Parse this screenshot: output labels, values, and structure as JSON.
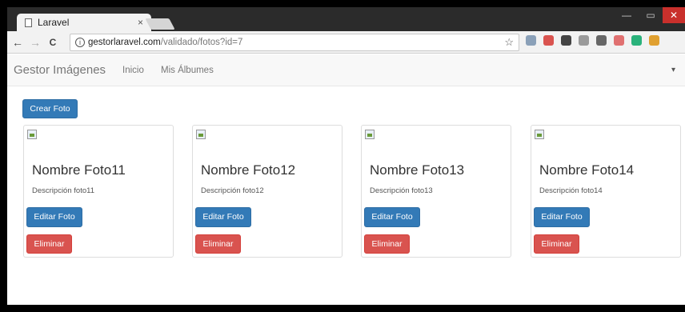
{
  "browser": {
    "tab_title": "Laravel",
    "tab_close": "×",
    "url_host": "gestorlaravel.com",
    "url_path": "/validado/fotos?id=7",
    "nav": {
      "back": "←",
      "forward": "→",
      "reload": "C"
    },
    "star": "☆",
    "extensions": [
      {
        "name": "download-icon",
        "color": "#8aa0b8"
      },
      {
        "name": "adblock-icon",
        "color": "#d9534f"
      },
      {
        "name": "extension-icon",
        "color": "#444444"
      },
      {
        "name": "cloud-icon",
        "color": "#9a9a9a"
      },
      {
        "name": "square-icon",
        "color": "#666666"
      },
      {
        "name": "cast-icon",
        "color": "#e07070"
      },
      {
        "name": "green-circle-icon",
        "color": "#2ab27b"
      },
      {
        "name": "hand-icon",
        "color": "#e0a030"
      }
    ]
  },
  "navbar": {
    "brand": "Gestor Imágenes",
    "links": [
      "Inicio",
      "Mis Álbumes"
    ],
    "caret": "▾"
  },
  "main": {
    "create_label": "Crear Foto",
    "cards": [
      {
        "title": "Nombre Foto11",
        "description": "Descripción foto11",
        "edit_label": "Editar Foto",
        "delete_label": "Eliminar"
      },
      {
        "title": "Nombre Foto12",
        "description": "Descripción foto12",
        "edit_label": "Editar Foto",
        "delete_label": "Eliminar"
      },
      {
        "title": "Nombre Foto13",
        "description": "Descripción foto13",
        "edit_label": "Editar Foto",
        "delete_label": "Eliminar"
      },
      {
        "title": "Nombre Foto14",
        "description": "Descripción foto14",
        "edit_label": "Editar Foto",
        "delete_label": "Eliminar"
      }
    ]
  },
  "colors": {
    "primary": "#337ab7",
    "danger": "#d9534f"
  }
}
